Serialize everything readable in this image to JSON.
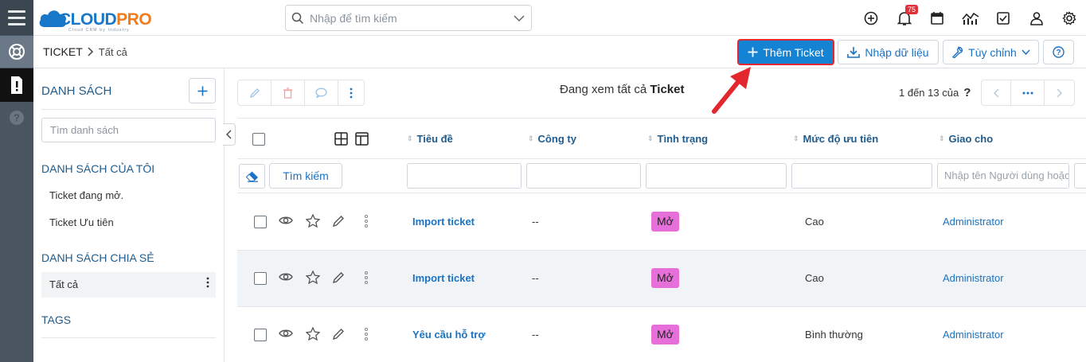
{
  "app": {
    "logo_main": "CLOUD",
    "logo_accent": "PRO",
    "logo_tagline": "Cloud CRM by Industry"
  },
  "header": {
    "search_placeholder": "Nhập để tìm kiếm",
    "notification_count": "75"
  },
  "breadcrumb": {
    "module": "TICKET",
    "view": "Tất cả"
  },
  "actions": {
    "add_label": "Thêm Ticket",
    "import_label": "Nhập dữ liệu",
    "customize_label": "Tùy chỉnh"
  },
  "sidebar": {
    "title": "DANH SÁCH",
    "search_placeholder": "Tìm danh sách",
    "my_lists_heading": "DANH SÁCH CỦA TÔI",
    "my_lists": [
      "Ticket đang mở.",
      "Ticket Ưu tiên"
    ],
    "shared_heading": "DANH SÁCH CHIA SẺ",
    "shared_lists": [
      "Tất cả"
    ],
    "tags_heading": "TAGS"
  },
  "listview": {
    "viewing_prefix": "Đang xem tất cả",
    "viewing_module": "Ticket",
    "pager_text": "1 đến 13 của",
    "pager_help": "?",
    "columns": [
      "Tiêu đề",
      "Công ty",
      "Tình trạng",
      "Mức độ ưu tiên",
      "Giao cho"
    ],
    "search_button": "Tìm kiếm",
    "assignee_filter_placeholder": "Nhập tên Người dùng hoặc Nhóm",
    "rows": [
      {
        "title": "Import ticket",
        "company": "--",
        "status": "Mở",
        "priority": "Cao",
        "assignee": "Administrator"
      },
      {
        "title": "Import ticket",
        "company": "--",
        "status": "Mở",
        "priority": "Cao",
        "assignee": "Administrator"
      },
      {
        "title": "Yêu cầu hỗ trợ",
        "company": "--",
        "status": "Mở",
        "priority": "Bình thường",
        "assignee": "Administrator"
      }
    ]
  },
  "colors": {
    "primary": "#1483d4",
    "status_open": "#e66fd9",
    "annotation_arrow": "#e2282e"
  }
}
